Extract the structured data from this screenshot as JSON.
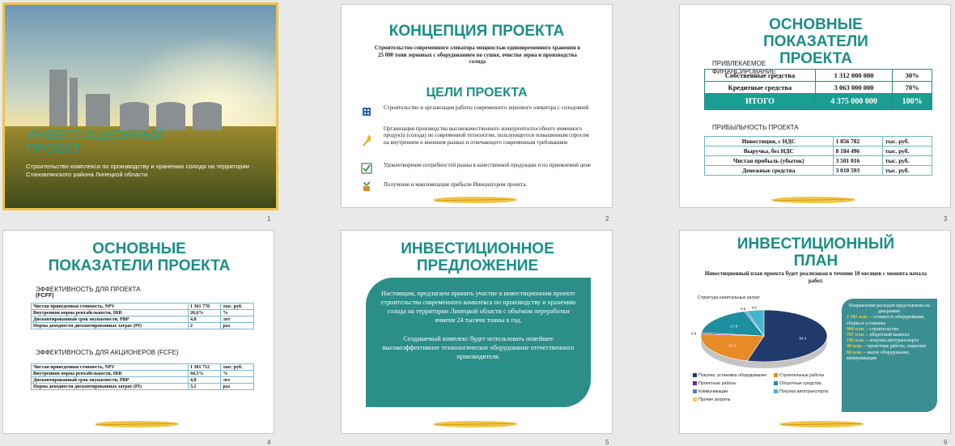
{
  "slides": [
    {
      "number": "1",
      "title": "ИНВЕСТИЦИОННЫЙ ПРОЕКТ",
      "subtitle": "Строительство  комплекса  по  производству и хранению солода на территории  Становлянского  района  Липецкой области"
    },
    {
      "number": "2",
      "title": "КОНЦЕПЦИЯ ПРОЕКТА",
      "intro": "Строительство современного элеватора мощностью единовременного хранения в 25 000 тонн зерновых с оборудованием по сушке, очистке зерна и производства солода",
      "goals_title": "ЦЕЛИ ПРОЕКТА",
      "goals": [
        "Строительство  и  организация  работы современного зернового элеватора с солодовней",
        "Организация производства высококачественного конкурентоспособного ячменного продукта (солода) по современной технологии, пользующегося повышенным  спросом на внутреннем и внешнем рынках и отвечающего современным  требованиям",
        "Удовлетворение потребностей рынка в качественной продукции и по приемлемой цене",
        "Получение и максимизация  прибыли Инициатором проекта."
      ]
    },
    {
      "number": "3",
      "title": "ОСНОВНЫЕ ПОКАЗАТЕЛИ ПРОЕКТА",
      "fin_title": "ПРИВЛЕКАЕМОЕ ФИНАНСИРОВАНИЕ",
      "fin_rows": [
        [
          "Собственные  средства",
          "1 312 000 000",
          "30%"
        ],
        [
          "Кредитные  средства",
          "3 063 000 000",
          "70%"
        ]
      ],
      "fin_total": [
        "ИТОГО",
        "4 375 000 000",
        "100%"
      ],
      "profit_title": "ПРИБЫЛЬНОСТЬ  ПРОЕКТА",
      "profit_rows": [
        [
          "Инвестиции, с НДС",
          "1 856 782",
          "тыс. руб."
        ],
        [
          "Выручка, без НДС",
          "8 184 496",
          "тыс. руб."
        ],
        [
          "Чистая прибыль (убыток)",
          "3 501 016",
          "тыс. руб."
        ],
        [
          "Денежные средства",
          "3 010 593",
          "тыс. руб."
        ]
      ]
    },
    {
      "number": "4",
      "title": "ОСНОВНЫЕ ПОКАЗАТЕЛИ ПРОЕКТА",
      "eff_title": "ЭФФЕКТИВНОСТЬ  ДЛЯ ПРОЕКТА",
      "eff_sub": "(FCFF)",
      "eff_rows": [
        [
          "Чистая приведенная  стоимость, NPV",
          "1 361 778",
          "тыс. руб."
        ],
        [
          "Внутренняя  норма рентабельности, IRR",
          "26,6%",
          "%"
        ],
        [
          "Дисконтированный  срок окупаемости, PBP",
          "4,8",
          "лет"
        ],
        [
          "Норма доходности дисконтированных затрат (PI)",
          "2",
          "раз"
        ]
      ],
      "sh_title": "ЭФФЕКТИВНОСТЬ  ДЛЯ АКЦИОНЕРОВ  (FCFE)",
      "sh_rows": [
        [
          "Чистая приведенная  стоимость, NPV",
          "1 301 712",
          "тыс. руб."
        ],
        [
          "Внутренняя  норма рентабельности, IRR",
          "44,5%",
          "%"
        ],
        [
          "Дисконтированный  срок окупаемости, PBP",
          "4,8",
          "лет"
        ],
        [
          "Норма доходности дисконтированных затрат (PI)",
          "3,1",
          "раз"
        ]
      ]
    },
    {
      "number": "5",
      "title": "ИНВЕСТИЦИОННОЕ ПРЕДЛОЖЕНИЕ",
      "p1": "Настоящим, предлагаем принять участие в инвестиционном проекте строительства современного комплекса по производству и хранению солода на территории Липецкой области с объёмом переработки ячменя 24 тысячи тонны в год.",
      "p2": "Создаваемый комплекс будет использовать новейшее высокоэффективное  технологическое оборудование отечественного производителя."
    },
    {
      "number": "6",
      "title": "ИНВЕСТИЦИОННЫЙ ПЛАН",
      "subtitle": "Инвестиционный план проекта будет реализован в течение 18 месяцев с момента начала работ.",
      "chart_caption": "Структура капитальных затрат",
      "box_title": "Направления расходов представлены на диаграмме:",
      "box_items": [
        [
          "2 382 млн.",
          " – стоимость оборудования, сборка и установка"
        ],
        [
          "960 млн.",
          " – строительство"
        ],
        [
          "787 млн.",
          " – оборотный капитал"
        ],
        [
          "198 млн.",
          " – покупка автотранспорта"
        ],
        [
          "40 млн.",
          " – проектные работы, лицензии"
        ],
        [
          "68 млн.",
          " – малое оборудование, коммуникации"
        ]
      ],
      "legend": [
        "Покупка, установка оборудования",
        "Строительные работы",
        "Проектные работы",
        "Оборотные средства",
        "Коммуникации",
        "Покупка автотранспорта",
        "Прочие затраты"
      ]
    }
  ],
  "chart_data": {
    "type": "pie",
    "title": "Структура капитальных затрат",
    "categories": [
      "Покупка, установка оборудования",
      "Строительные работы",
      "Проектные работы",
      "Оборотные средства",
      "Коммуникации",
      "Покупка автотранспорта",
      "Прочие затраты"
    ],
    "values": [
      54.4,
      21.9,
      0.9,
      17.9,
      0.6,
      4.5,
      0.0
    ],
    "labels": [
      "54.4",
      "21.9",
      "0.9",
      "17.9",
      "0.6",
      "4.5",
      "0"
    ],
    "colors": [
      "#1f3a6b",
      "#e88a25",
      "#6a2c91",
      "#1d8fa0",
      "#5a7fc1",
      "#45b6d0",
      "#f4c86a"
    ]
  }
}
